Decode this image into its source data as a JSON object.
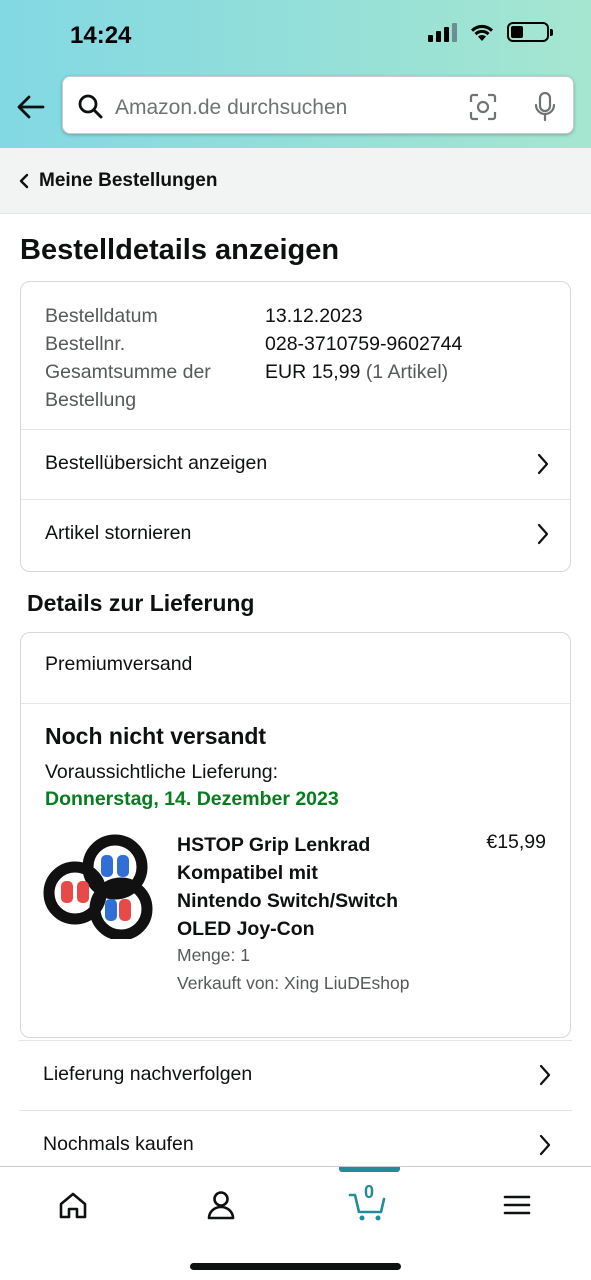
{
  "status_bar": {
    "time": "14:24"
  },
  "search": {
    "placeholder": "Amazon.de durchsuchen"
  },
  "breadcrumb": {
    "label": "Meine Bestellungen"
  },
  "page_title": "Bestelldetails anzeigen",
  "order_info": {
    "date_label": "Bestelldatum",
    "date_value": "13.12.2023",
    "number_label": "Bestellnr.",
    "number_value": "028-3710759-9602744",
    "total_label_line1": "Gesamtsumme der",
    "total_label_line2": "Bestellung",
    "total_value": "EUR 15,99",
    "total_items": "(1 Artikel)"
  },
  "order_links": [
    {
      "label": "Bestellübersicht anzeigen"
    },
    {
      "label": "Artikel stornieren"
    }
  ],
  "delivery": {
    "section_title": "Details zur Lieferung",
    "shipping_method": "Premiumversand",
    "status": "Noch nicht versandt",
    "eta_label": "Voraussichtliche Lieferung:",
    "eta_date": "Donnerstag, 14. Dezember 2023",
    "product": {
      "title_lines": [
        "HSTOP Grip Lenkrad",
        "Kompatibel mit",
        "Nintendo Switch/Switch",
        "OLED Joy-Con"
      ],
      "price": "€15,99",
      "quantity": "Menge: 1",
      "seller": "Verkauft von: Xing LiuDEshop"
    }
  },
  "actions": [
    {
      "label": "Lieferung nachverfolgen"
    },
    {
      "label": "Nochmals kaufen"
    }
  ],
  "tabbar": {
    "tabs": [
      {
        "icon": "home-icon"
      },
      {
        "icon": "account-icon"
      },
      {
        "icon": "cart-icon"
      },
      {
        "icon": "menu-icon"
      }
    ],
    "cart_count": "0",
    "accent_color": "#238b97"
  },
  "colors": {
    "delivery_date": "#067d1e"
  }
}
